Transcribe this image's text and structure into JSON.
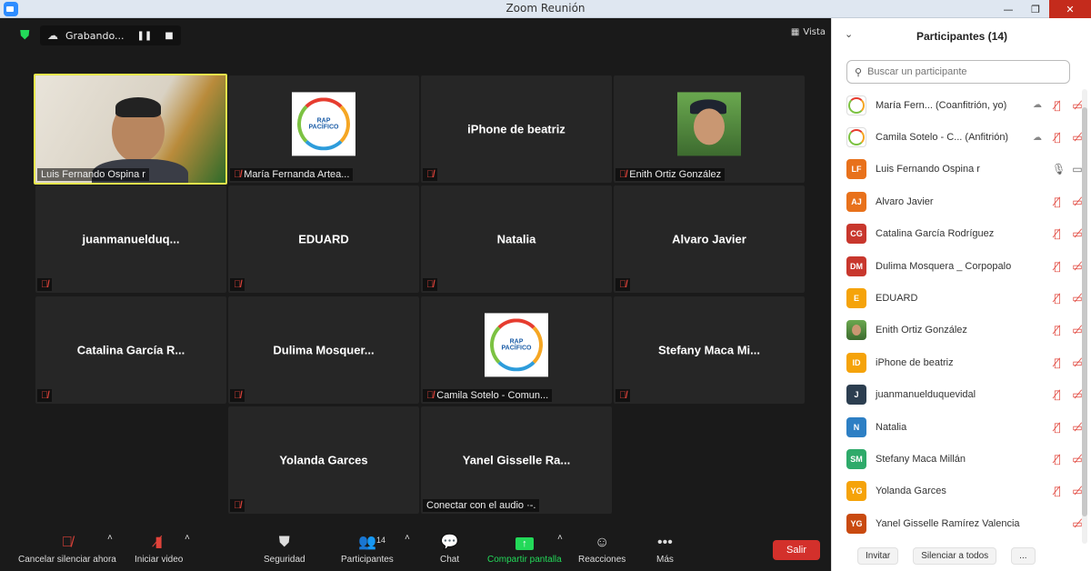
{
  "window": {
    "title": "Zoom Reunión",
    "minimize": "—",
    "maximize": "❐",
    "close": "✕"
  },
  "meeting": {
    "recording_label": "Grabando...",
    "view_label": "Vista",
    "tiles": [
      {
        "label": "Luis Fernando Ospina r",
        "type": "video"
      },
      {
        "label": "María Fernanda Artea...",
        "type": "logo",
        "logo_line1": "RAP",
        "logo_line2": "PACÍFICO"
      },
      {
        "name": "iPhone de beatriz"
      },
      {
        "label": "Enith Ortiz González",
        "type": "photo"
      },
      {
        "name": "juanmanuelduq..."
      },
      {
        "name": "EDUARD"
      },
      {
        "name": "Natalia"
      },
      {
        "name": "Alvaro Javier"
      },
      {
        "name": "Catalina García R..."
      },
      {
        "name": "Dulima  Mosquer..."
      },
      {
        "label": "Camila Sotelo - Comun...",
        "type": "logo",
        "logo_line1": "RAP",
        "logo_line2": "PACÍFICO"
      },
      {
        "name": "Stefany Maca Mi..."
      },
      {
        "name": "Yolanda Garces"
      },
      {
        "name": "Yanel Gisselle Ra...",
        "audio_label": "Conectar con el audio ·-."
      }
    ]
  },
  "toolbar": {
    "mute": "Cancelar silenciar ahora",
    "video": "Iniciar video",
    "security": "Seguridad",
    "participants": "Participantes",
    "participants_count": "14",
    "chat": "Chat",
    "share": "Compartir pantalla",
    "reactions": "Reacciones",
    "more": "Más",
    "leave": "Salir"
  },
  "panel": {
    "title": "Participantes (14)",
    "search_placeholder": "Buscar un participante",
    "participants": [
      {
        "name": "María Fern...  (Coanfitrión, yo)",
        "avatar": "",
        "color": "",
        "mic": "muted",
        "cam": "off",
        "cloud": true
      },
      {
        "name": "Camila Sotelo - C...  (Anfitrión)",
        "avatar": "",
        "color": "",
        "mic": "muted",
        "cam": "off",
        "cloud": true
      },
      {
        "name": "Luis Fernando Ospina r",
        "avatar": "LF",
        "color": "#e8711b",
        "mic": "on",
        "cam": "on"
      },
      {
        "name": "Alvaro Javier",
        "avatar": "AJ",
        "color": "#e8711b",
        "mic": "muted",
        "cam": "off"
      },
      {
        "name": "Catalina García Rodríguez",
        "avatar": "CG",
        "color": "#c8372d",
        "mic": "muted",
        "cam": "off"
      },
      {
        "name": "Dulima Mosquera _ Corpopalo",
        "avatar": "DM",
        "color": "#c8372d",
        "mic": "muted",
        "cam": "off"
      },
      {
        "name": "EDUARD",
        "avatar": "E",
        "color": "#f5a30a",
        "mic": "muted",
        "cam": "off"
      },
      {
        "name": "Enith Ortiz González",
        "avatar": "",
        "color": "",
        "mic": "muted",
        "cam": "off"
      },
      {
        "name": "iPhone de beatriz",
        "avatar": "ID",
        "color": "#f5a30a",
        "mic": "muted",
        "cam": "off"
      },
      {
        "name": "juanmanuelduquevidal",
        "avatar": "J",
        "color": "#2c3e50",
        "mic": "muted",
        "cam": "off"
      },
      {
        "name": "Natalia",
        "avatar": "N",
        "color": "#2d7fc4",
        "mic": "muted",
        "cam": "off"
      },
      {
        "name": "Stefany Maca Millán",
        "avatar": "SM",
        "color": "#2eaa6a",
        "mic": "muted",
        "cam": "off"
      },
      {
        "name": "Yolanda Garces",
        "avatar": "YG",
        "color": "#f5a30a",
        "mic": "muted",
        "cam": "off"
      },
      {
        "name": "Yanel Gisselle Ramírez Valencia",
        "avatar": "YG",
        "color": "#c94a10",
        "mic": "none",
        "cam": "off"
      }
    ],
    "invite": "Invitar",
    "mute_all": "Silenciar a todos",
    "more": "..."
  }
}
